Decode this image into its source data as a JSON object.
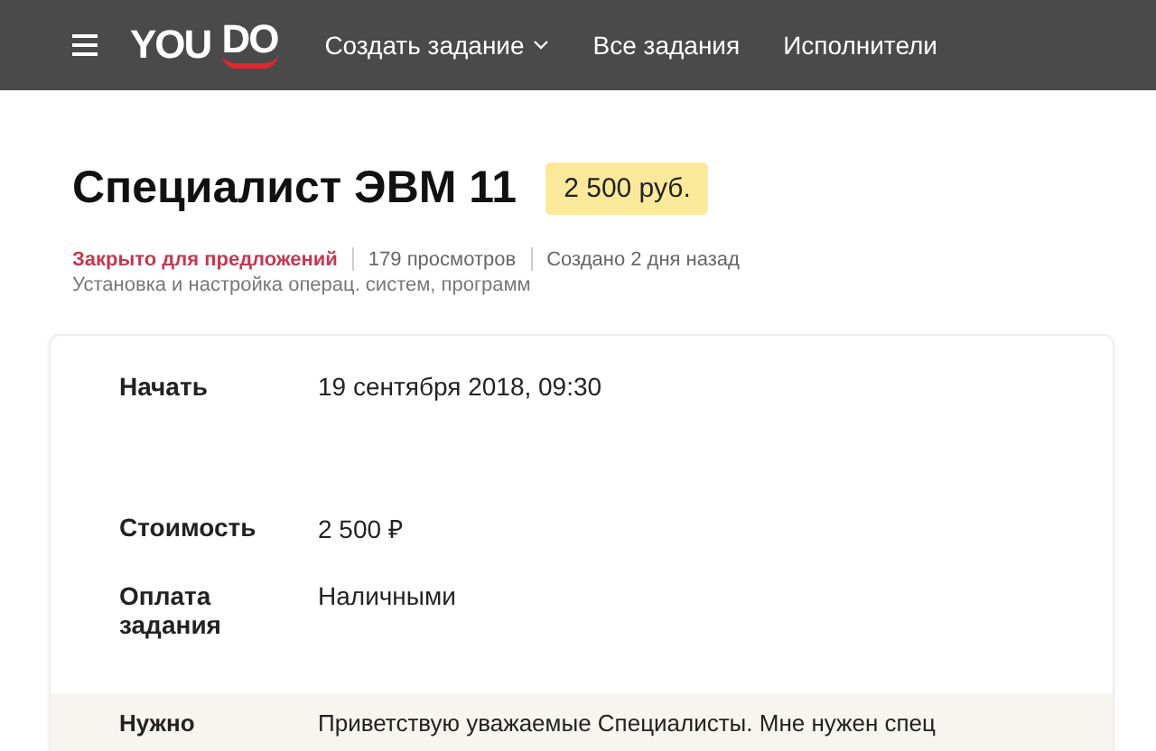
{
  "nav": {
    "logo": {
      "you": "YOU",
      "do": "DO"
    },
    "items": [
      {
        "label": "Создать задание",
        "dropdown": true
      },
      {
        "label": "Все задания",
        "dropdown": false
      },
      {
        "label": "Исполнители",
        "dropdown": false
      }
    ]
  },
  "task": {
    "title": "Специалист ЭВМ 11",
    "price": "2 500 руб.",
    "status": "Закрыто для предложений",
    "views": "179 просмотров",
    "created": "Создано 2 дня назад",
    "category": "Установка и настройка операц. систем, программ"
  },
  "details": [
    {
      "label": "Начать",
      "value": "19 сентября 2018, 09:30",
      "highlight": false
    },
    {
      "label": "Стоимость",
      "value": "2 500 ₽",
      "highlight": false
    },
    {
      "label": "Оплата задания",
      "value": "Наличными",
      "highlight": false
    },
    {
      "label": "Нужно",
      "value": "Приветствую уважаемые Специалисты. Мне нужен спец",
      "highlight": true
    }
  ]
}
